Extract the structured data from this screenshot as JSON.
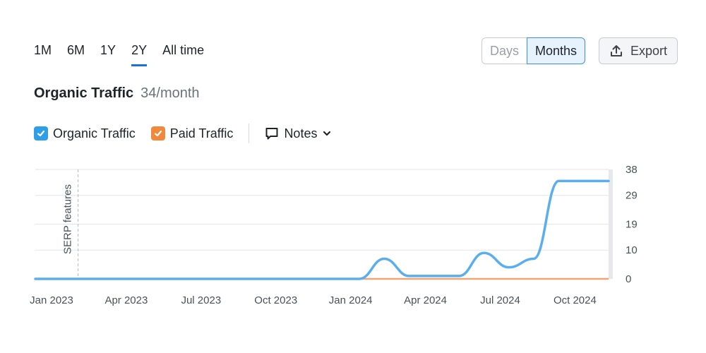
{
  "period_tabs": [
    {
      "label": "1M",
      "active": false
    },
    {
      "label": "6M",
      "active": false
    },
    {
      "label": "1Y",
      "active": false
    },
    {
      "label": "2Y",
      "active": true
    },
    {
      "label": "All time",
      "active": false
    }
  ],
  "view_toggle": {
    "days_label": "Days",
    "months_label": "Months",
    "selected": "Months"
  },
  "export": {
    "label": "Export",
    "icon": "upload-icon"
  },
  "header": {
    "title": "Organic Traffic",
    "value": "34/month"
  },
  "legend": {
    "organic_label": "Organic Traffic",
    "paid_label": "Paid Traffic",
    "notes_label": "Notes",
    "organic_color": "#2e9ee8",
    "paid_color": "#f0893b"
  },
  "chart_data": {
    "type": "line",
    "x_labels": [
      "Jan 2023",
      "Apr 2023",
      "Jul 2023",
      "Oct 2023",
      "Jan 2024",
      "Apr 2024",
      "Jul 2024",
      "Oct 2024"
    ],
    "y_ticks": [
      0,
      10,
      19,
      29,
      38
    ],
    "ylim": [
      0,
      38
    ],
    "annotation": {
      "label": "SERP features",
      "x": "Mar 2023"
    },
    "series": [
      {
        "name": "Organic Traffic",
        "color": "#5aaeee",
        "x": [
          "Jan 2023",
          "Feb 2023",
          "Mar 2023",
          "Apr 2023",
          "May 2023",
          "Jun 2023",
          "Jul 2023",
          "Aug 2023",
          "Sep 2023",
          "Oct 2023",
          "Nov 2023",
          "Dec 2023",
          "Jan 2024",
          "Feb 2024",
          "Mar 2024",
          "Apr 2024",
          "May 2024",
          "Jun 2024",
          "Jul 2024",
          "Aug 2024",
          "Sep 2024",
          "Oct 2024",
          "Nov 2024",
          "Dec 2024"
        ],
        "values": [
          0,
          0,
          0,
          0,
          0,
          0,
          0,
          0,
          0,
          0,
          0,
          0,
          0,
          0,
          7,
          1,
          1,
          1,
          9,
          4,
          7,
          34,
          34,
          34
        ]
      },
      {
        "name": "Paid Traffic",
        "color": "#f2a574",
        "x": [
          "Jan 2023",
          "Feb 2023",
          "Mar 2023",
          "Apr 2023",
          "May 2023",
          "Jun 2023",
          "Jul 2023",
          "Aug 2023",
          "Sep 2023",
          "Oct 2023",
          "Nov 2023",
          "Dec 2023",
          "Jan 2024",
          "Feb 2024",
          "Mar 2024",
          "Apr 2024",
          "May 2024",
          "Jun 2024",
          "Jul 2024",
          "Aug 2024",
          "Sep 2024",
          "Oct 2024",
          "Nov 2024",
          "Dec 2024"
        ],
        "values": [
          0,
          0,
          0,
          0,
          0,
          0,
          0,
          0,
          0,
          0,
          0,
          0,
          0,
          0,
          0,
          0,
          0,
          0,
          0,
          0,
          0,
          0,
          0,
          0
        ]
      }
    ],
    "grid": true,
    "y_axis_position": "right"
  }
}
